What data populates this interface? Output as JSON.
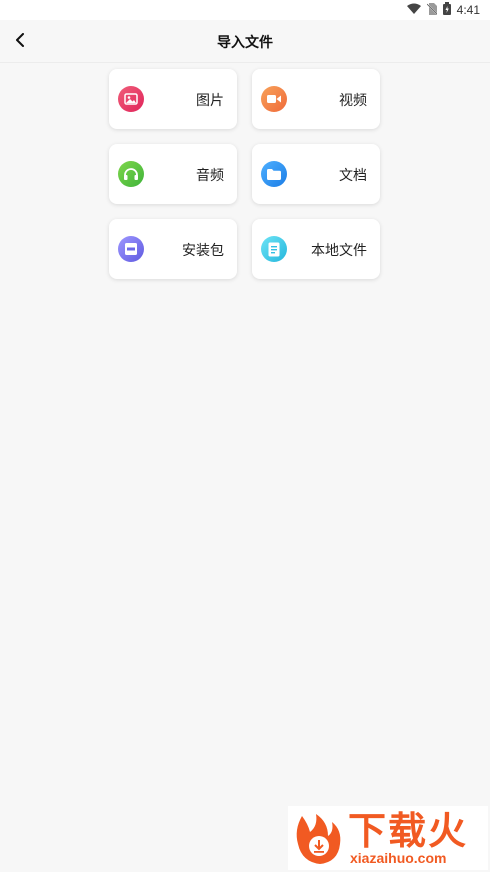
{
  "status": {
    "time": "4:41"
  },
  "header": {
    "title": "导入文件"
  },
  "cards": [
    {
      "label": "图片",
      "icon": "image-icon",
      "color": "#e63d66"
    },
    {
      "label": "视频",
      "icon": "video-icon",
      "color": "#f07d45"
    },
    {
      "label": "音频",
      "icon": "headphones-icon",
      "color": "#4cbe3f"
    },
    {
      "label": "文档",
      "icon": "folder-icon",
      "color": "#2b8ff0"
    },
    {
      "label": "安装包",
      "icon": "apk-icon",
      "color": "#6c68e8"
    },
    {
      "label": "本地文件",
      "icon": "file-icon",
      "color": "#33c0e3"
    }
  ],
  "watermark": {
    "title": "下载火",
    "subtitle": "xiazaihuo.com",
    "color": "#f15a22"
  }
}
